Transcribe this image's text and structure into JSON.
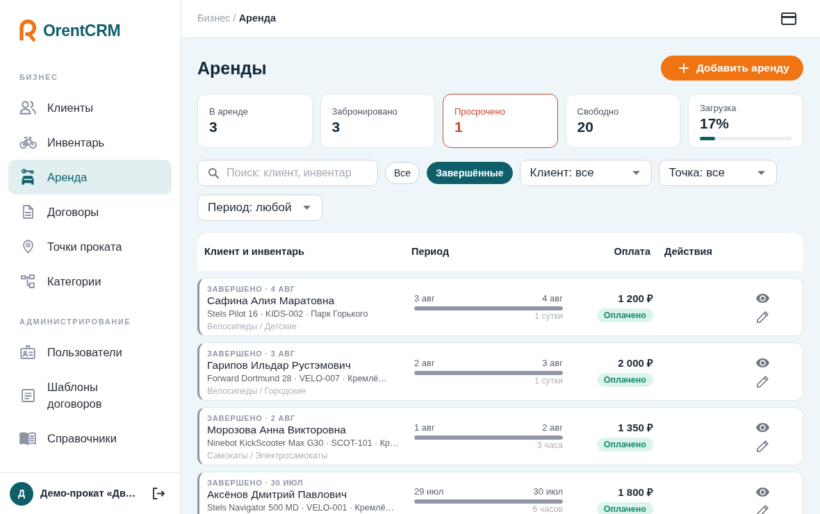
{
  "sidebar": {
    "logo": "OrentCRM",
    "sections": [
      {
        "title": "БИЗНЕС",
        "items": [
          {
            "label": "Клиенты",
            "selected": false
          },
          {
            "label": "Инвентарь",
            "selected": false
          },
          {
            "label": "Аренда",
            "selected": true
          },
          {
            "label": "Договоры",
            "selected": false
          },
          {
            "label": "Точки проката",
            "selected": false
          },
          {
            "label": "Категории",
            "selected": false
          }
        ]
      },
      {
        "title": "АДМИНИСТРИРОВАНИЕ",
        "items": [
          {
            "label": "Пользователи",
            "selected": false
          },
          {
            "label": "Шаблоны договоров",
            "selected": false
          },
          {
            "label": "Справочники",
            "selected": false
          }
        ]
      }
    ],
    "account": {
      "initial": "Д",
      "name": "Демо-прокат «Дв…"
    }
  },
  "breadcrumb": {
    "items": [
      "Бизнес",
      "Аренда"
    ],
    "separator": "/"
  },
  "page_title": "Аренды",
  "add_button": {
    "label": "Добавить аренду"
  },
  "stats": [
    {
      "label": "В аренде",
      "value": "3",
      "alert": false
    },
    {
      "label": "Забронировано",
      "value": "3",
      "alert": false
    },
    {
      "label": "Просрочено",
      "value": "1",
      "alert": true
    },
    {
      "label": "Свободно",
      "value": "20",
      "alert": false
    },
    {
      "label": "Загрузка",
      "value": "17%",
      "alert": false,
      "level": 0.17
    }
  ],
  "filters": {
    "search": {
      "placeholder": "Поиск: клиент, инвентар"
    },
    "chips": [
      {
        "label": "Все",
        "selected": false
      },
      {
        "label": "Завершённые",
        "selected": true
      }
    ],
    "dropdowns": [
      {
        "label": "Клиент: все"
      },
      {
        "label": "Точка: все"
      },
      {
        "label": "Период: любой"
      }
    ]
  },
  "table": {
    "columns": [
      "Клиент и инвентарь",
      "Период",
      "Оплата",
      "Действия"
    ],
    "rows": [
      {
        "status": "ЗАВЕРШЕНО · 4 АВГ",
        "client": "Сафина Алия Маратовна",
        "item": "Stels Pilot 16 · KIDS-002 · Парк Горького",
        "category": "Велосипеды / Детские",
        "start": "3 авг",
        "end": "4 авг",
        "level": 1,
        "duration": "1 сутки",
        "amount": "1 200 ₽",
        "payment_status": "Оплачено"
      },
      {
        "status": "ЗАВЕРШЕНО · 3 АВГ",
        "client": "Гарипов Ильдар Рустэмович",
        "item": "Forward Dortmund 28 · VELO-007 · Кремлё…",
        "category": "Велосипеды / Городские",
        "start": "2 авг",
        "end": "3 авг",
        "level": 1,
        "duration": "1 сутки",
        "amount": "2 000 ₽",
        "payment_status": "Оплачено"
      },
      {
        "status": "ЗАВЕРШЕНО · 2 АВГ",
        "client": "Морозова Анна Викторовна",
        "item": "Ninebot KickScooter Max G30 · SCOT-101 · Кр…",
        "category": "Самокаты / Электросамокаты",
        "start": "1 авг",
        "end": "2 авг",
        "level": 1,
        "duration": "3 часа",
        "amount": "1 350 ₽",
        "payment_status": "Оплачено"
      },
      {
        "status": "ЗАВЕРШЕНО · 30 ИЮЛ",
        "client": "Аксёнов Дмитрий Павлович",
        "item": "Stels Navigator 500 MD · VELO-001 · Кремлё…",
        "start": "29 июл",
        "end": "30 июл",
        "level": 1,
        "duration": "6 часов",
        "amount": "1 800 ₽",
        "payment_status": "Оплачено"
      }
    ]
  }
}
